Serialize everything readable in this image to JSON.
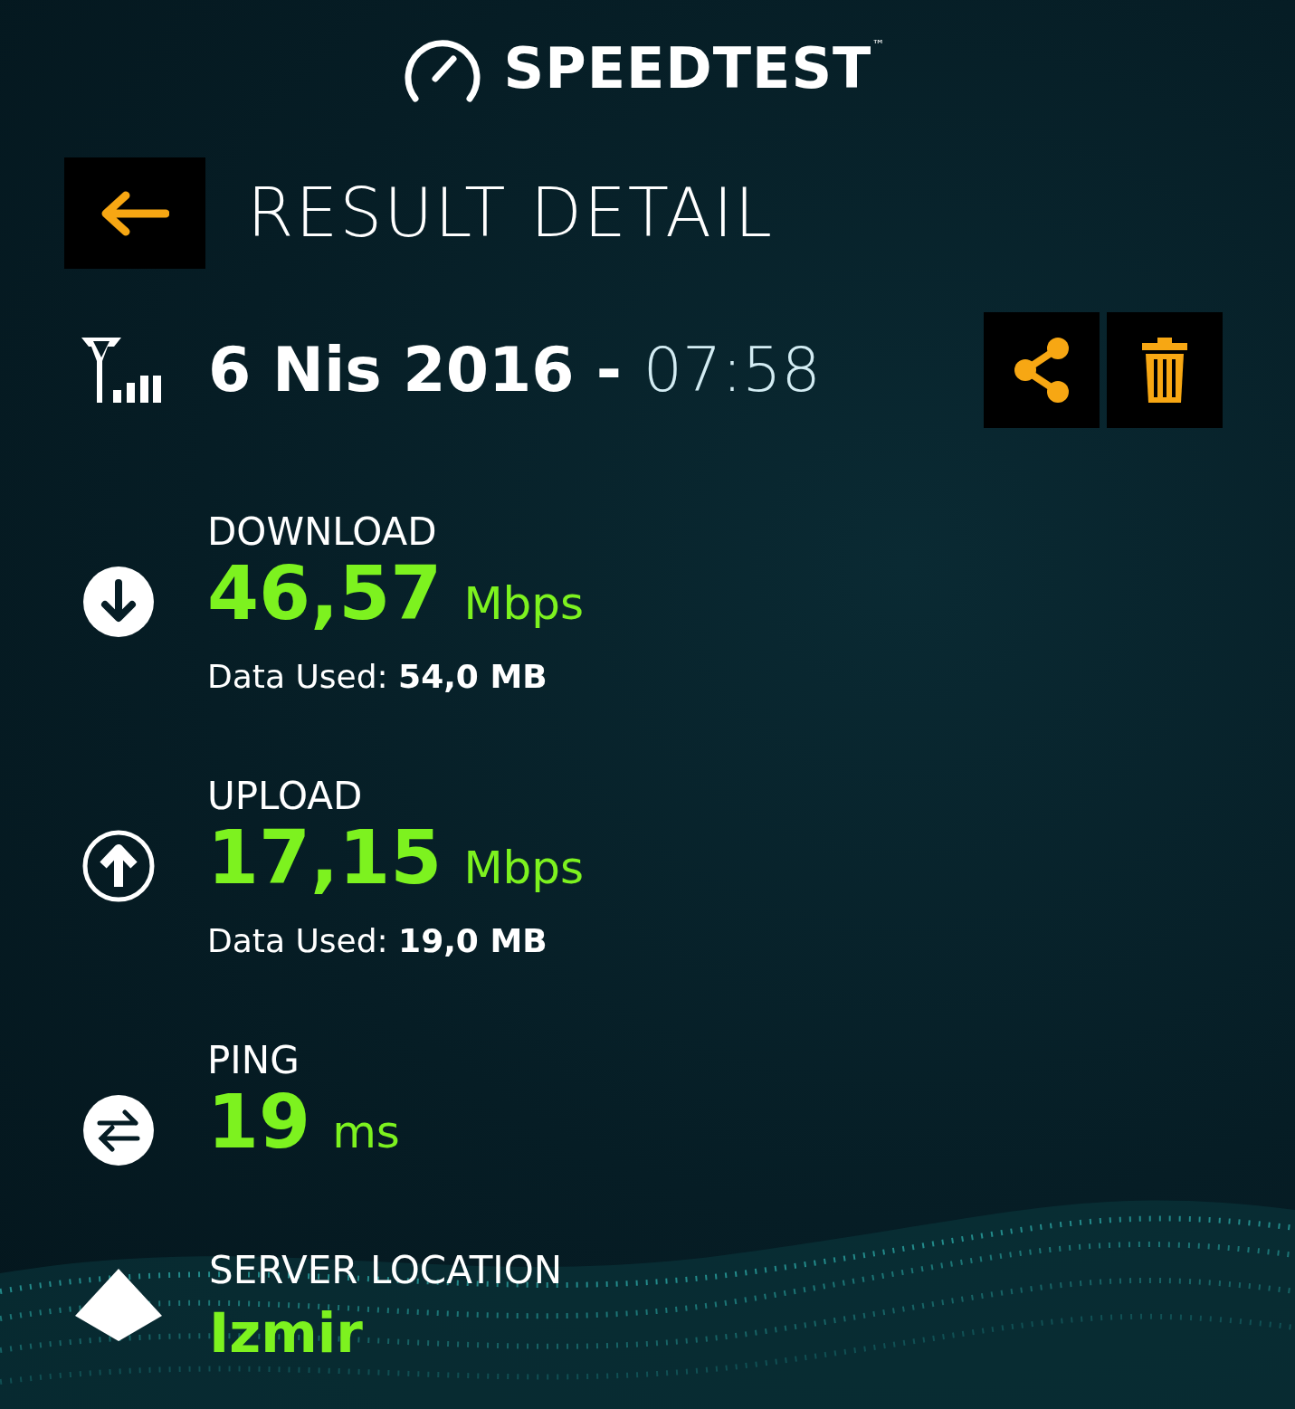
{
  "app": {
    "logo": "SPEEDTEST",
    "trademark": "™"
  },
  "header": {
    "title": "RESULT DETAIL"
  },
  "result": {
    "date": "6 Nis 2016",
    "separator": "-",
    "time": "07:58"
  },
  "metrics": [
    {
      "kind": "download",
      "label": "DOWNLOAD",
      "value": "46,57",
      "unit": "Mbps",
      "data_used": "Data Used: **54,0 MB**"
    },
    {
      "kind": "upload",
      "label": "UPLOAD",
      "value": "17,15",
      "unit": "Mbps",
      "data_used": "Data Used: **19,0 MB**"
    },
    {
      "kind": "ping",
      "label": "PING",
      "value": "19",
      "unit": "ms"
    }
  ],
  "server": {
    "label": "SERVER LOCATION",
    "value": "Izmir"
  }
}
